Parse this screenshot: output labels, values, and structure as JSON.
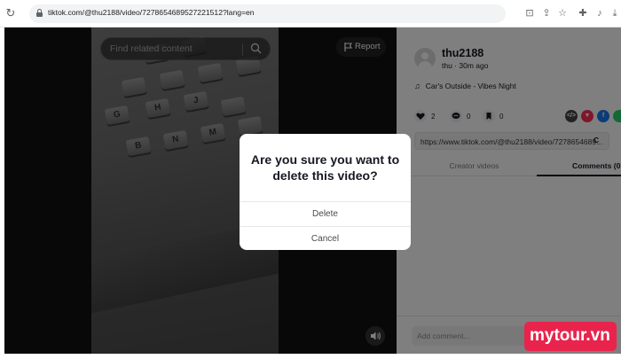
{
  "browser": {
    "url": "tiktok.com/@thu2188/video/7278654689527221512?lang=en"
  },
  "video": {
    "search_placeholder": "Find related content",
    "report_label": "Report",
    "keys": [
      "G",
      "B",
      "N",
      "M",
      "H",
      "J"
    ]
  },
  "panel": {
    "username": "thu2188",
    "subline": "thu · 30m ago",
    "music": "Car's Outside - Vibes Night",
    "likes": "2",
    "comments": "0",
    "saves": "0",
    "link": "https://www.tiktok.com/@thu2188/video/7278654689...",
    "copy_label": "C",
    "tabs": [
      "Creator videos",
      "Comments (0"
    ],
    "comment_placeholder": "Add comment..."
  },
  "dialog": {
    "title": "Are you sure you want to delete this video?",
    "delete_label": "Delete",
    "cancel_label": "Cancel"
  },
  "watermark": {
    "text": "mytour.vn"
  },
  "colors": {
    "accent": "#fe2c55",
    "watermark": "#e8244d",
    "text_primary": "#161823"
  }
}
